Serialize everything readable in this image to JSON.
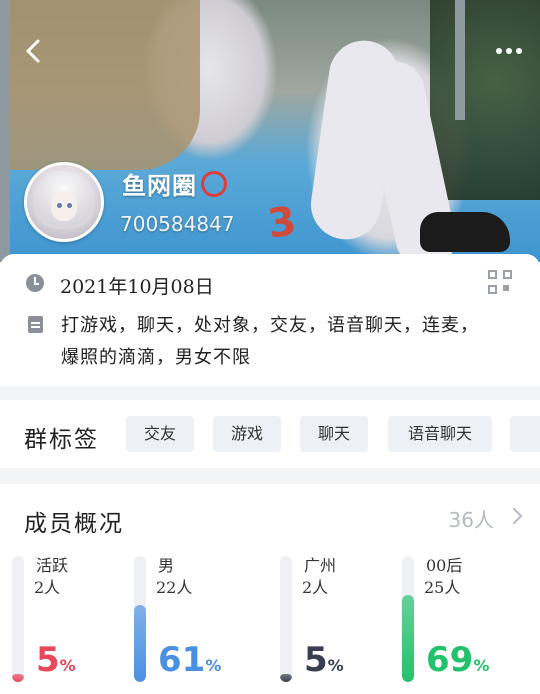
{
  "header": {
    "group_name": "鱼网圈",
    "group_id": "700584847",
    "back_icon": "chevron-left-icon",
    "more_icon": "more-dots-icon"
  },
  "info": {
    "date": "2021年10月08日",
    "description": "打游戏，聊天，处对象，交友，语音聊天，连麦，爆照的滴滴，男女不限",
    "date_icon": "clock-icon",
    "desc_icon": "document-icon",
    "qr_icon": "qr-code-icon"
  },
  "tags": {
    "title": "群标签",
    "items": [
      "交友",
      "游戏",
      "聊天",
      "语音聊天"
    ]
  },
  "members": {
    "title": "成员概况",
    "count": "36人",
    "stats": [
      {
        "label": "活跃",
        "count": "2人",
        "percent": "5",
        "fraction": 0.05,
        "color": "#e8485a"
      },
      {
        "label": "男",
        "count": "22人",
        "percent": "61",
        "fraction": 0.61,
        "color": "#4a90e2"
      },
      {
        "label": "广州",
        "count": "2人",
        "percent": "5",
        "fraction": 0.05,
        "color": "#3a3f4f"
      },
      {
        "label": "00后",
        "count": "25人",
        "percent": "69",
        "fraction": 0.69,
        "color": "#23c16b"
      }
    ]
  }
}
